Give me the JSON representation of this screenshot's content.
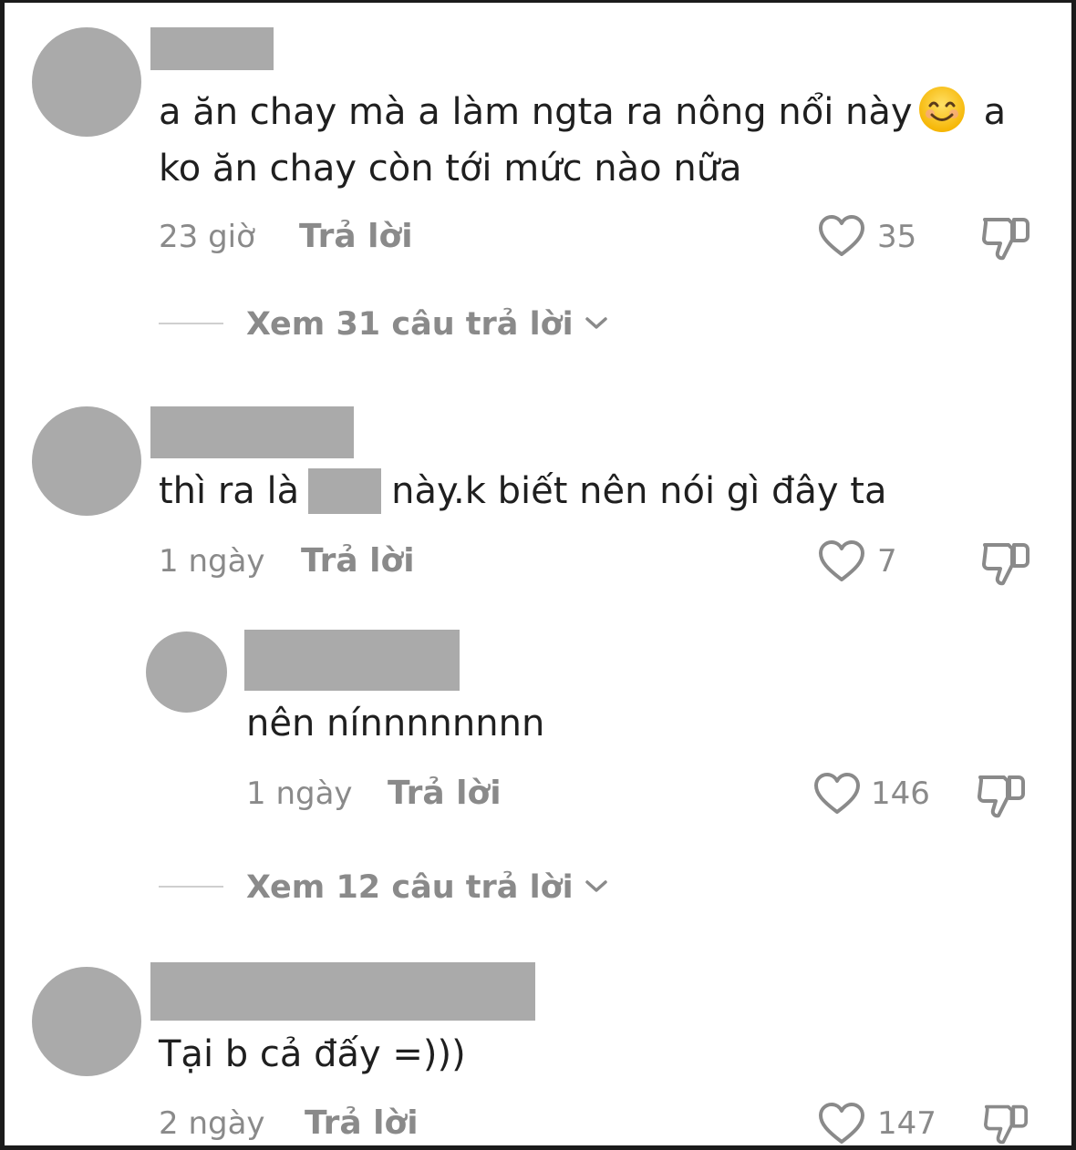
{
  "comments": [
    {
      "text_line1": "a ăn chay mà a làm ngta ra nông nổi này",
      "emoji": "smiling-face-emoji",
      "text_line1_end": "a",
      "text_line2": "ko ăn chay còn tới mức nào nữa",
      "time": "23 giờ",
      "reply_label": "Trả lời",
      "likes": "35",
      "view_replies": "Xem 31 câu trả lời"
    },
    {
      "text_before": "thì ra là",
      "text_after": "này.k biết nên nói gì đây ta",
      "time": "1 ngày",
      "reply_label": "Trả lời",
      "likes": "7",
      "reply": {
        "text": "nên nínnnnnnnn",
        "time": "1 ngày",
        "reply_label": "Trả lời",
        "likes": "146"
      },
      "view_replies": "Xem 12 câu trả lời"
    },
    {
      "text": "Tại b cả đấy =)))",
      "time": "2 ngày",
      "reply_label": "Trả lời",
      "likes": "147"
    }
  ],
  "icons": {
    "like": "heart-outline-icon",
    "dislike": "thumbs-down-icon",
    "expand": "chevron-down-icon"
  },
  "colors": {
    "text": "#1f1f1f",
    "muted": "#8a8a8a",
    "placeholder": "#aaaaaa",
    "border": "#1b1b1b"
  }
}
